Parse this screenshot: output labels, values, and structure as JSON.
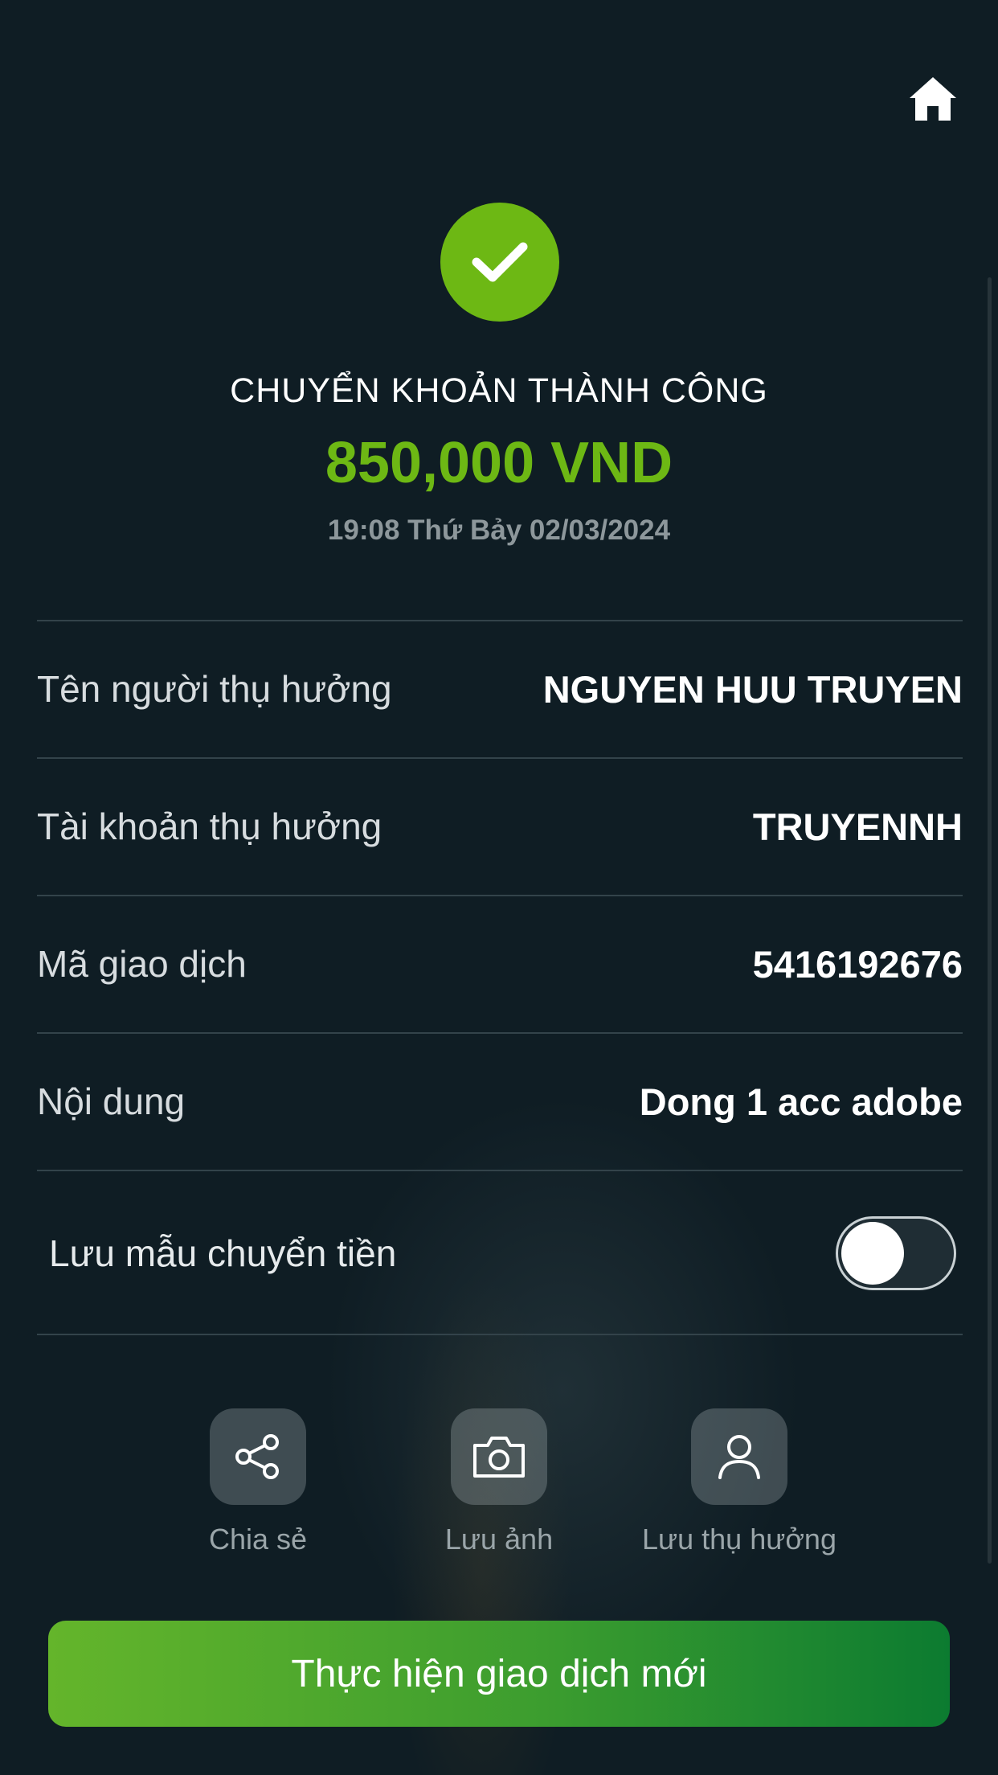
{
  "header": {
    "home_icon": "home-icon"
  },
  "status": {
    "icon": "check-icon",
    "title": "CHUYỂN KHOẢN THÀNH CÔNG",
    "amount": "850,000 VND",
    "datetime": "19:08 Thứ Bảy 02/03/2024",
    "accent_color": "#6db814"
  },
  "details": [
    {
      "label": "Tên người thụ hưởng",
      "value": "NGUYEN HUU TRUYEN"
    },
    {
      "label": "Tài khoản thụ hưởng",
      "value": "TRUYENNH"
    },
    {
      "label": "Mã giao dịch",
      "value": "5416192676"
    },
    {
      "label": "Nội dung",
      "value": "Dong 1 acc adobe"
    }
  ],
  "save_template": {
    "label": "Lưu mẫu chuyển tiền",
    "enabled": false
  },
  "actions": [
    {
      "label": "Chia sẻ",
      "icon": "share-icon"
    },
    {
      "label": "Lưu ảnh",
      "icon": "camera-icon"
    },
    {
      "label": "Lưu thụ hưởng",
      "icon": "user-icon"
    }
  ],
  "primary_button": {
    "label": "Thực hiện giao dịch mới"
  }
}
